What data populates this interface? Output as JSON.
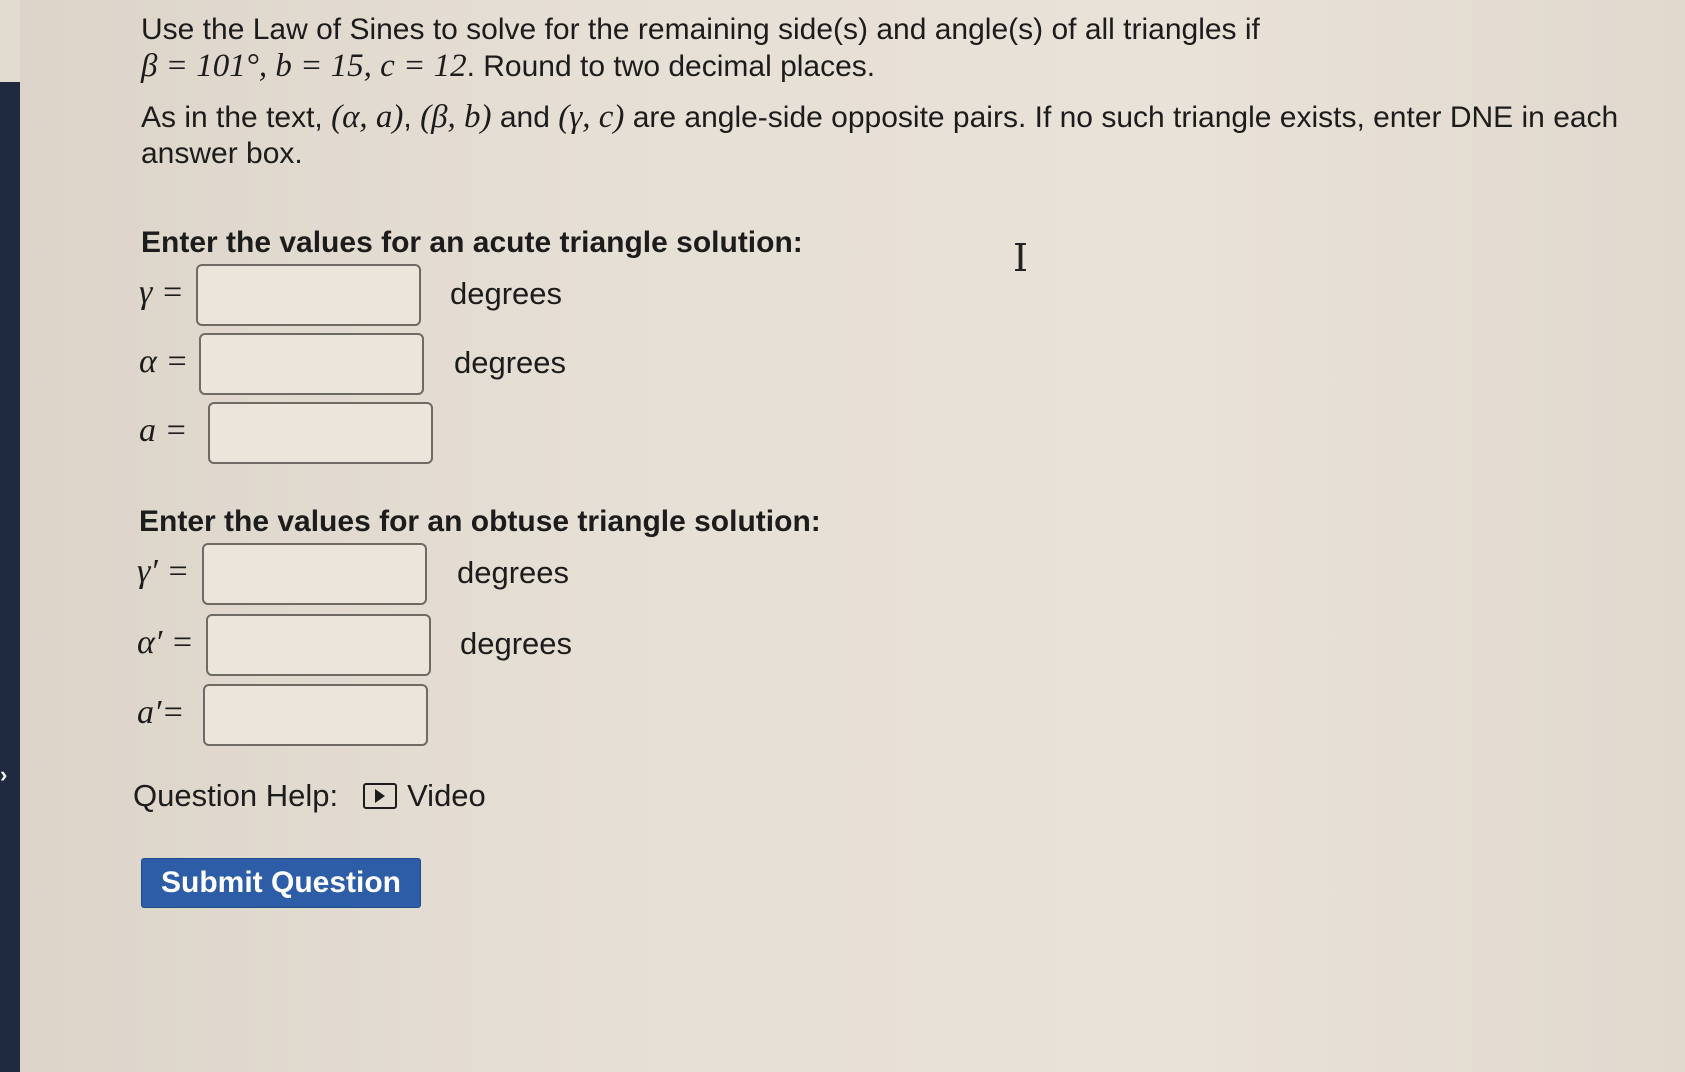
{
  "problem": {
    "line1": "Use the Law of Sines to solve for the remaining side(s) and angle(s) of all triangles if",
    "line2_math": "β = 101°, b = 15, c = 12",
    "line2_text": ". Round to two decimal places.",
    "para2_a": "As in the text, ",
    "pair1": "(α, a)",
    "sep1": ", ",
    "pair2": "(β, b)",
    "and": " and ",
    "pair3": "(γ, c)",
    "para2_b": " are angle-side opposite pairs. If no such triangle exists, enter DNE in each answer box."
  },
  "acute": {
    "title": "Enter the values for an acute triangle solution:",
    "rows": [
      {
        "label": "γ =",
        "value": "",
        "unit": "degrees"
      },
      {
        "label": "α =",
        "value": "",
        "unit": "degrees"
      },
      {
        "label": "a =",
        "value": "",
        "unit": ""
      }
    ]
  },
  "obtuse": {
    "title": "Enter the values for an obtuse triangle solution:",
    "rows": [
      {
        "label": "γ′ =",
        "value": "",
        "unit": "degrees"
      },
      {
        "label": "α′ =",
        "value": "",
        "unit": "degrees"
      },
      {
        "label": "a′=",
        "value": "",
        "unit": ""
      }
    ]
  },
  "help": {
    "label": "Question Help:",
    "video_label": "Video",
    "video_icon": "play-video-icon"
  },
  "submit": {
    "label": "Submit Question"
  },
  "colors": {
    "submit_bg": "#2c5da6",
    "page_bg": "#e4ddd3",
    "left_bar": "#1f2a3f"
  }
}
